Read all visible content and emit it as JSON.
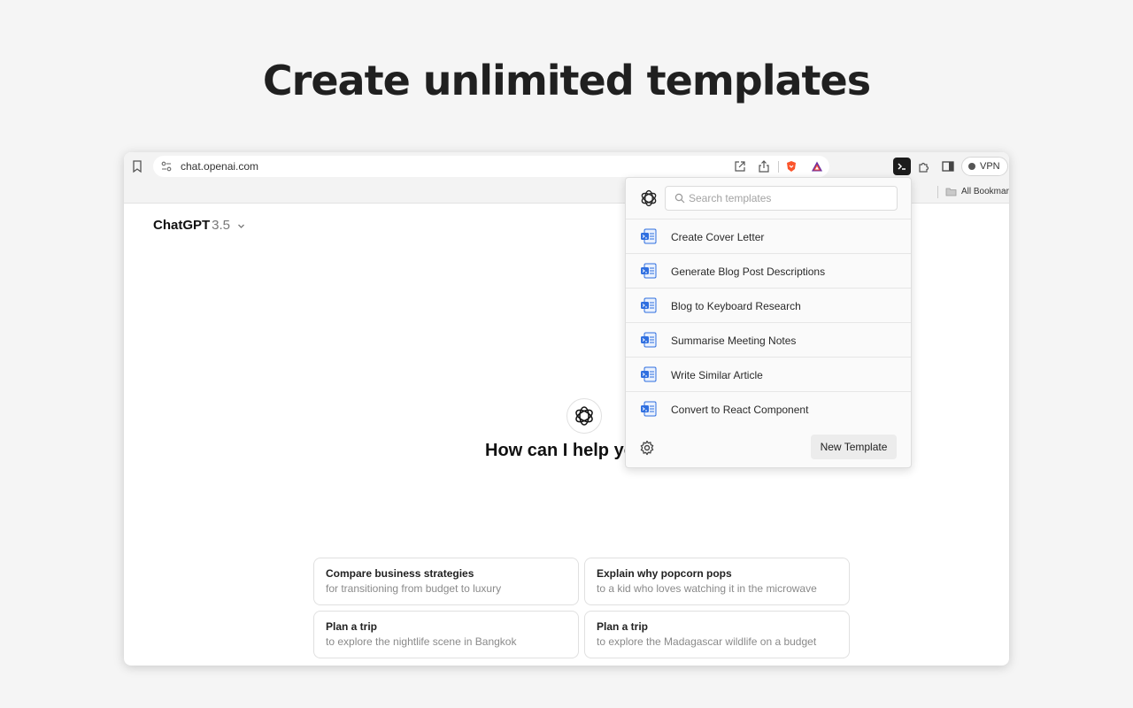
{
  "hero": {
    "title": "Create unlimited templates"
  },
  "browser": {
    "url": "chat.openai.com",
    "vpn_label": "VPN",
    "bookmarks_label": "All Bookmarks"
  },
  "chat": {
    "model_name": "ChatGPT",
    "model_version": "3.5",
    "help_prompt": "How can I help you today?",
    "suggestions": [
      {
        "title": "Compare business strategies",
        "subtitle": "for transitioning from budget to luxury"
      },
      {
        "title": "Explain why popcorn pops",
        "subtitle": "to a kid who loves watching it in the microwave"
      },
      {
        "title": "Plan a trip",
        "subtitle": "to explore the nightlife scene in Bangkok"
      },
      {
        "title": "Plan a trip",
        "subtitle": "to explore the Madagascar wildlife on a budget"
      }
    ]
  },
  "popup": {
    "search_placeholder": "Search templates",
    "templates": [
      {
        "label": "Create Cover Letter"
      },
      {
        "label": "Generate Blog Post Descriptions"
      },
      {
        "label": "Blog to Keyboard Research"
      },
      {
        "label": "Summarise Meeting Notes"
      },
      {
        "label": "Write Similar Article"
      },
      {
        "label": "Convert to React Component"
      }
    ],
    "new_template_label": "New Template"
  },
  "colors": {
    "template_icon_accent": "#2f6fe0",
    "brave_orange": "#fb542b",
    "extension_active": "#1c1c1c"
  },
  "icons": [
    "bookmark-icon",
    "site-settings-icon",
    "open-external-icon",
    "share-icon",
    "brave-shield-icon",
    "brave-rewards-icon",
    "terminal-extension-icon",
    "puzzle-extensions-icon",
    "sidebar-toggle-icon",
    "folder-icon",
    "openai-logo-icon",
    "search-icon",
    "template-doc-icon",
    "gear-icon"
  ]
}
